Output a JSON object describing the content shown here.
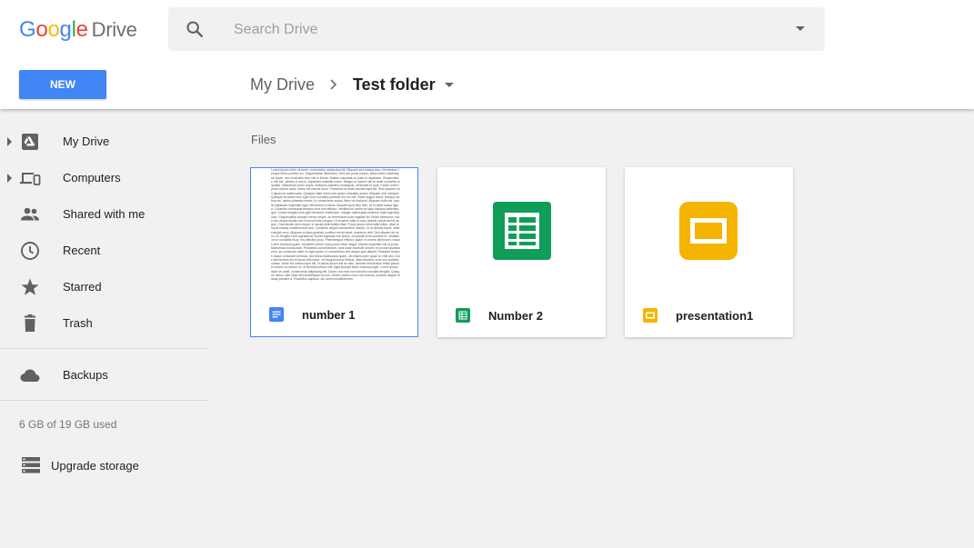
{
  "logo": {
    "brand": "Google",
    "product": "Drive"
  },
  "search": {
    "placeholder": "Search Drive",
    "value": ""
  },
  "new_button": {
    "label": "NEW"
  },
  "breadcrumb": {
    "root": "My Drive",
    "current": "Test folder"
  },
  "sidebar": {
    "items": [
      {
        "label": "My Drive",
        "icon": "my-drive-icon",
        "expandable": true
      },
      {
        "label": "Computers",
        "icon": "computers-icon",
        "expandable": true
      },
      {
        "label": "Shared with me",
        "icon": "shared-icon",
        "expandable": false
      },
      {
        "label": "Recent",
        "icon": "clock-icon",
        "expandable": false
      },
      {
        "label": "Starred",
        "icon": "star-icon",
        "expandable": false
      },
      {
        "label": "Trash",
        "icon": "trash-icon",
        "expandable": false
      }
    ],
    "backups": {
      "label": "Backups",
      "icon": "cloud-icon"
    },
    "storage_text": "6 GB of 19 GB used",
    "upgrade": {
      "label": "Upgrade storage",
      "icon": "storage-icon"
    }
  },
  "main": {
    "section_title": "Files",
    "files": [
      {
        "name": "number 1",
        "type": "document",
        "icon": "docs-icon",
        "color": "#4285f4",
        "selected": true
      },
      {
        "name": "Number 2",
        "type": "spreadsheet",
        "icon": "sheets-icon",
        "color": "#0f9d58",
        "selected": false
      },
      {
        "name": "presentation1",
        "type": "presentation",
        "icon": "slides-icon",
        "color": "#f4b400",
        "selected": false
      }
    ]
  },
  "colors": {
    "accent": "#4285f4",
    "sheets": "#0f9d58",
    "slides": "#f4b400",
    "docs": "#4285f4"
  }
}
